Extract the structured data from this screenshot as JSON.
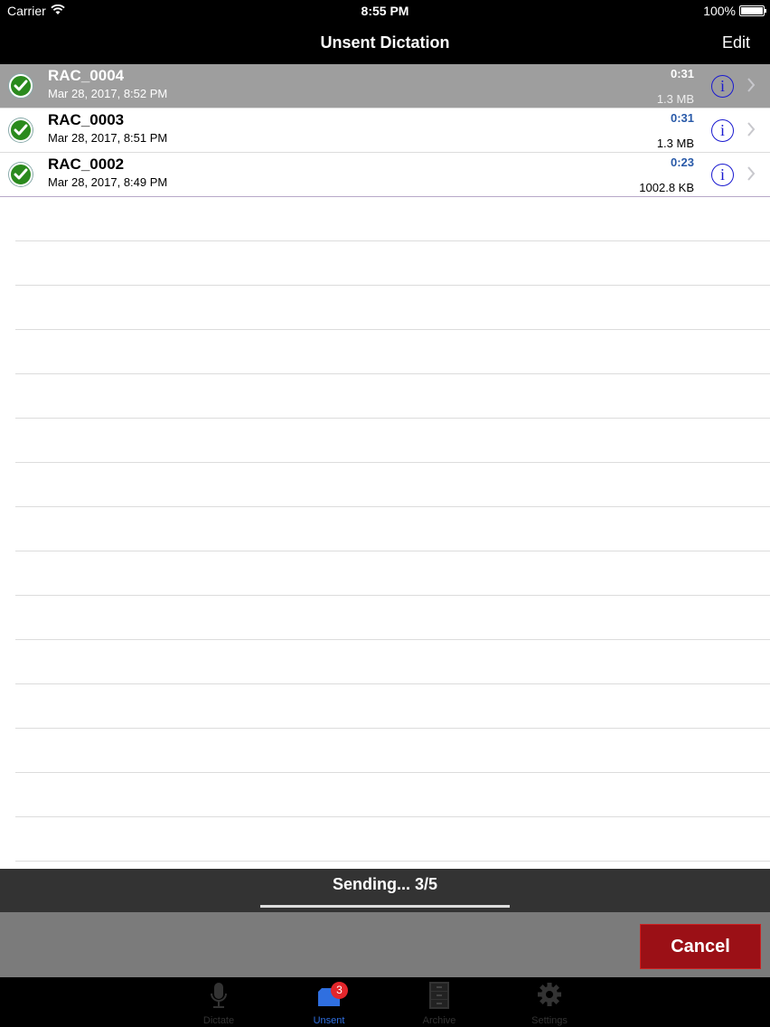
{
  "status_bar": {
    "carrier": "Carrier",
    "time": "8:55 PM",
    "battery": "100%"
  },
  "nav": {
    "title": "Unsent Dictation",
    "edit_label": "Edit"
  },
  "dictations": [
    {
      "name": "RAC_0004",
      "date": "Mar 28, 2017, 8:52 PM",
      "duration": "0:31",
      "size": "1.3 MB",
      "selected": true
    },
    {
      "name": "RAC_0003",
      "date": "Mar 28, 2017, 8:51 PM",
      "duration": "0:31",
      "size": "1.3 MB",
      "selected": false
    },
    {
      "name": "RAC_0002",
      "date": "Mar 28, 2017, 8:49 PM",
      "duration": "0:23",
      "size": "1002.8 KB",
      "selected": false
    }
  ],
  "sending": {
    "text": "Sending... 3/5",
    "progress": 1.0
  },
  "actions": {
    "cancel_label": "Cancel"
  },
  "tabs": [
    {
      "label": "Dictate",
      "icon": "microphone-icon",
      "active": false
    },
    {
      "label": "Unsent",
      "icon": "inbox-icon",
      "active": true,
      "badge": "3"
    },
    {
      "label": "Archive",
      "icon": "archive-icon",
      "active": false
    },
    {
      "label": "Settings",
      "icon": "gear-icon",
      "active": false
    }
  ],
  "colors": {
    "accent": "#2f6fe0",
    "duration_blue": "#2859a8",
    "check_green": "#2a8a1d",
    "cancel_red": "#9b1016",
    "badge_red": "#e3262b"
  }
}
